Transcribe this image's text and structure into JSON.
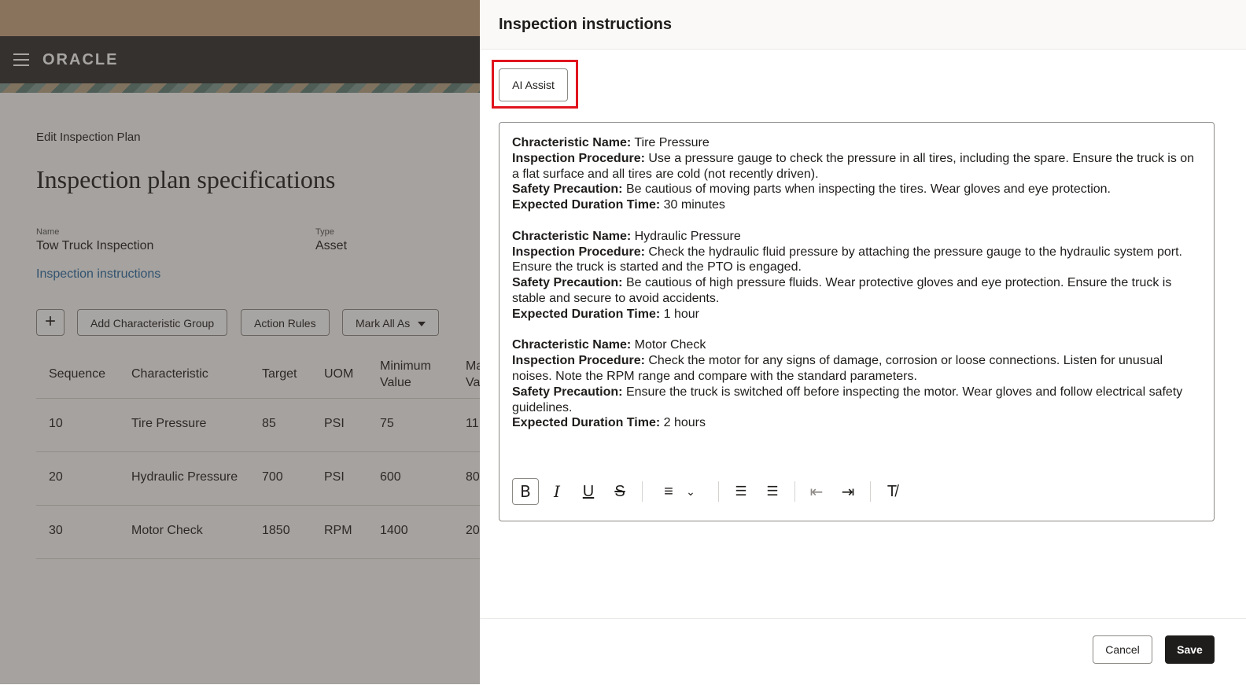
{
  "app": {
    "logo": "ORACLE"
  },
  "background": {
    "breadcrumb": "Edit Inspection Plan",
    "title": "Inspection plan specifications",
    "fields": {
      "name_label": "Name",
      "name_value": "Tow Truck Inspection",
      "type_label": "Type",
      "type_value": "Asset"
    },
    "instructions_link": "Inspection instructions",
    "toolbar": {
      "add_label": "+",
      "add_group_label": "Add Characteristic Group",
      "action_rules_label": "Action Rules",
      "mark_all_label": "Mark All As"
    },
    "table": {
      "headers": [
        "Sequence",
        "Characteristic",
        "Target",
        "UOM",
        "Minimum",
        "Value",
        "Ma",
        "Va"
      ],
      "rows": [
        [
          "10",
          "Tire Pressure",
          "85",
          "PSI",
          "75",
          "11"
        ],
        [
          "20",
          "Hydraulic Pressure",
          "700",
          "PSI",
          "600",
          "80"
        ],
        [
          "30",
          "Motor Check",
          "1850",
          "RPM",
          "1400",
          "20"
        ]
      ]
    }
  },
  "drawer": {
    "title": "Inspection instructions",
    "ai_assist_label": "AI Assist",
    "content": {
      "labels": {
        "name": "Chracteristic Name:",
        "procedure": "Inspection Procedure:",
        "safety": "Safety Precaution:",
        "duration": "Expected Duration Time:"
      },
      "blocks": [
        {
          "name": "Tire Pressure",
          "procedure": "Use a pressure gauge to check the pressure in all tires, including the spare. Ensure the truck is on a flat surface and all tires are cold (not recently driven).",
          "safety": "Be cautious of moving parts when inspecting the tires. Wear gloves and eye protection.",
          "duration": "30 minutes"
        },
        {
          "name": "Hydraulic Pressure",
          "procedure": "Check the hydraulic fluid pressure by attaching the pressure gauge to the hydraulic system port. Ensure the truck is started and the PTO is engaged.",
          "safety": "Be cautious of high pressure fluids. Wear protective gloves and eye protection. Ensure the truck is stable and secure to avoid accidents.",
          "duration": "1 hour"
        },
        {
          "name": "Motor Check",
          "procedure": "Check the motor for any signs of damage, corrosion or loose connections. Listen for unusual noises. Note the RPM range and compare with the standard parameters.",
          "safety": "Ensure the truck is switched off before inspecting the motor. Wear gloves and follow electrical safety guidelines.",
          "duration": "2 hours"
        }
      ]
    },
    "editor_toolbar": {
      "bold": "B",
      "italic": "I",
      "underline": "U",
      "strikethrough": "S",
      "align": "≡",
      "align_caret": "⌄",
      "bullet_list": "☰",
      "numbered_list": "☰",
      "outdent": "⇤",
      "indent": "⇥",
      "clear_format": "T̸"
    },
    "cancel_label": "Cancel",
    "save_label": "Save"
  },
  "colors": {
    "highlight": "#e0141e",
    "primary_button": "#1f1d1b",
    "navbar": "#312d2a",
    "link": "#2b6aa0"
  }
}
